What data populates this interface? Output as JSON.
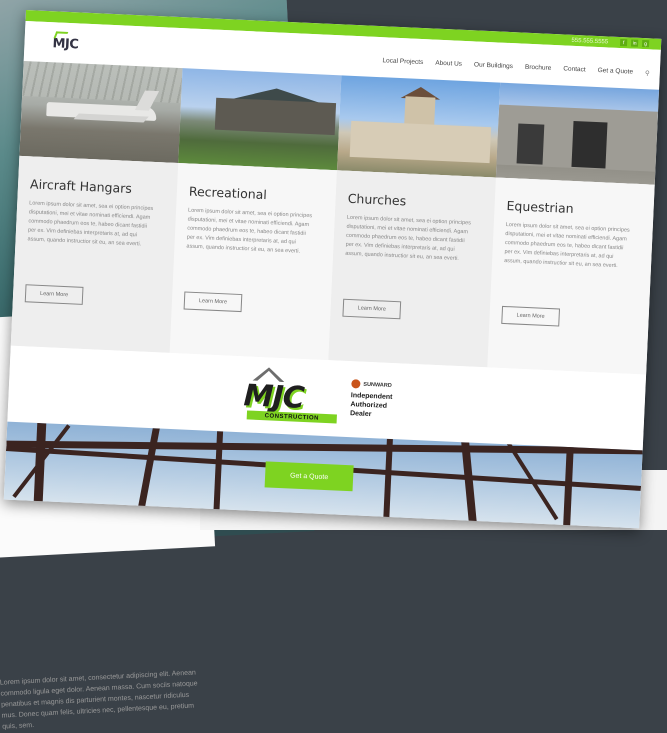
{
  "background_page": {
    "text": "Lorem ipsum dolor sit amet, consectetur adipiscing elit. Aenean commodo ligula eget dolor. Aenean massa. Cum sociis natoque penatibus et magnis dis parturient montes, nascetur ridiculus mus. Donec quam felis, ultricies nec, pellentesque eu, pretium quis, sem."
  },
  "topbar": {
    "phone": "555.555.5555",
    "social": [
      "f",
      "in",
      "g"
    ]
  },
  "header": {
    "logo": "MJC",
    "nav": [
      "Local Projects",
      "About Us",
      "Our Buildings",
      "Brochure",
      "Contact",
      "Get a Quote"
    ],
    "search_icon": "search-icon"
  },
  "cards": [
    {
      "title": "Aircraft Hangars",
      "text": "Lorem ipsum dolor sit amet, sea ei option principes disputationi, mei et vitae nominati efficiendi. Agam commodo phaedrum eos te, habeo dicant fastidii per ex. Vim definiebas interpretaris at, ad qui assum, quando instructior sit eu, an sea everti.",
      "button": "Learn More"
    },
    {
      "title": "Recreational",
      "text": "Lorem ipsum dolor sit amet, sea ei option principes disputationi, mei et vitae nominati efficiendi. Agam commodo phaedrum eos te, habeo dicant fastidii per ex. Vim definiebas interpretaris at, ad qui assum, quando instructior sit eu, an sea everti.",
      "button": "Learn More"
    },
    {
      "title": "Churches",
      "text": "Lorem ipsum dolor sit amet, sea ei option principes disputationi, mei et vitae nominati efficiendi. Agam commodo phaedrum eos te, habeo dicant fastidii per ex. Vim definiebas interpretaris at, ad qui assum, quando instructior sit eu, an sea everti.",
      "button": "Learn More"
    },
    {
      "title": "Equestrian",
      "text": "Lorem ipsum dolor sit amet, sea ei option principes disputationi, mei et vitae nominati efficiendi. Agam commodo phaedrum eos te, habeo dicant fastidii per ex. Vim definiebas interpretaris at, ad qui assum, quando instructior sit eu, an sea everti.",
      "button": "Learn More"
    }
  ],
  "logo_band": {
    "big_logo": "MJC",
    "big_logo_sub": "CONSTRUCTION",
    "dealer_brand": "SUNWARD",
    "dealer_lines": [
      "Independent",
      "Authorized",
      "Dealer"
    ]
  },
  "cta": {
    "label": "Get a Quote"
  },
  "colors": {
    "accent": "#7ed321",
    "text_dark": "#333333"
  }
}
